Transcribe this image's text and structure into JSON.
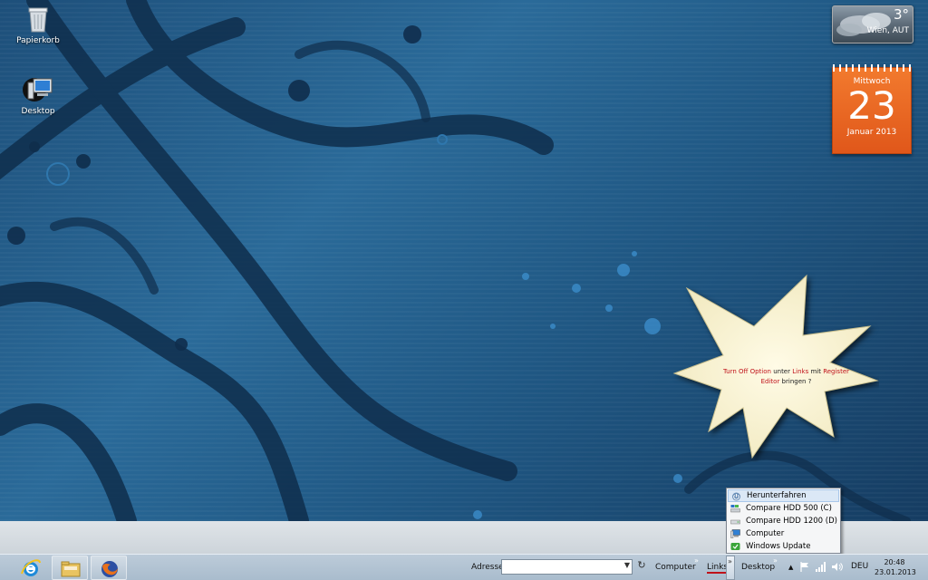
{
  "desktop": {
    "icons": [
      {
        "label": "Papierkorb",
        "icon": "recycle-bin-icon"
      },
      {
        "label": "Desktop",
        "icon": "computer-icon"
      }
    ]
  },
  "weather": {
    "temperature": "3°",
    "location": "Wien, AUT"
  },
  "calendar": {
    "weekday": "Mittwoch",
    "day": "23",
    "month_year": "Januar 2013"
  },
  "callout": {
    "part1": "Turn Off Option",
    "part2": " unter ",
    "part3": "Links",
    "part4": " mit ",
    "part5": "Register Editor",
    "part6": " bringen ?",
    "accent_color": "#c0121a"
  },
  "links_menu": {
    "items": [
      {
        "label": "Herunterfahren",
        "icon": "power-icon",
        "highlighted": true
      },
      {
        "label": "Compare HDD 500 (C)",
        "icon": "drive-icon"
      },
      {
        "label": "Compare HDD 1200 (D)",
        "icon": "drive-icon"
      },
      {
        "label": "Computer",
        "icon": "computer-icon"
      },
      {
        "label": "Windows Update",
        "icon": "windows-update-icon"
      }
    ]
  },
  "taskbar": {
    "apps": [
      {
        "name": "Internet Explorer",
        "icon": "internet-explorer-icon"
      },
      {
        "name": "Explorer",
        "icon": "folder-icon"
      },
      {
        "name": "Firefox",
        "icon": "firefox-icon"
      }
    ],
    "address_label": "Adresse",
    "address_value": "",
    "toolbars": [
      "Computer",
      "Links",
      "Desktop"
    ],
    "chevron": "»",
    "tray": {
      "language": "DEU",
      "time": "20:48",
      "date": "23.01.2013"
    }
  },
  "colors": {
    "wallpaper": "#1f5783",
    "calendar": "#e0571a",
    "taskbar": "#a9bccd"
  }
}
